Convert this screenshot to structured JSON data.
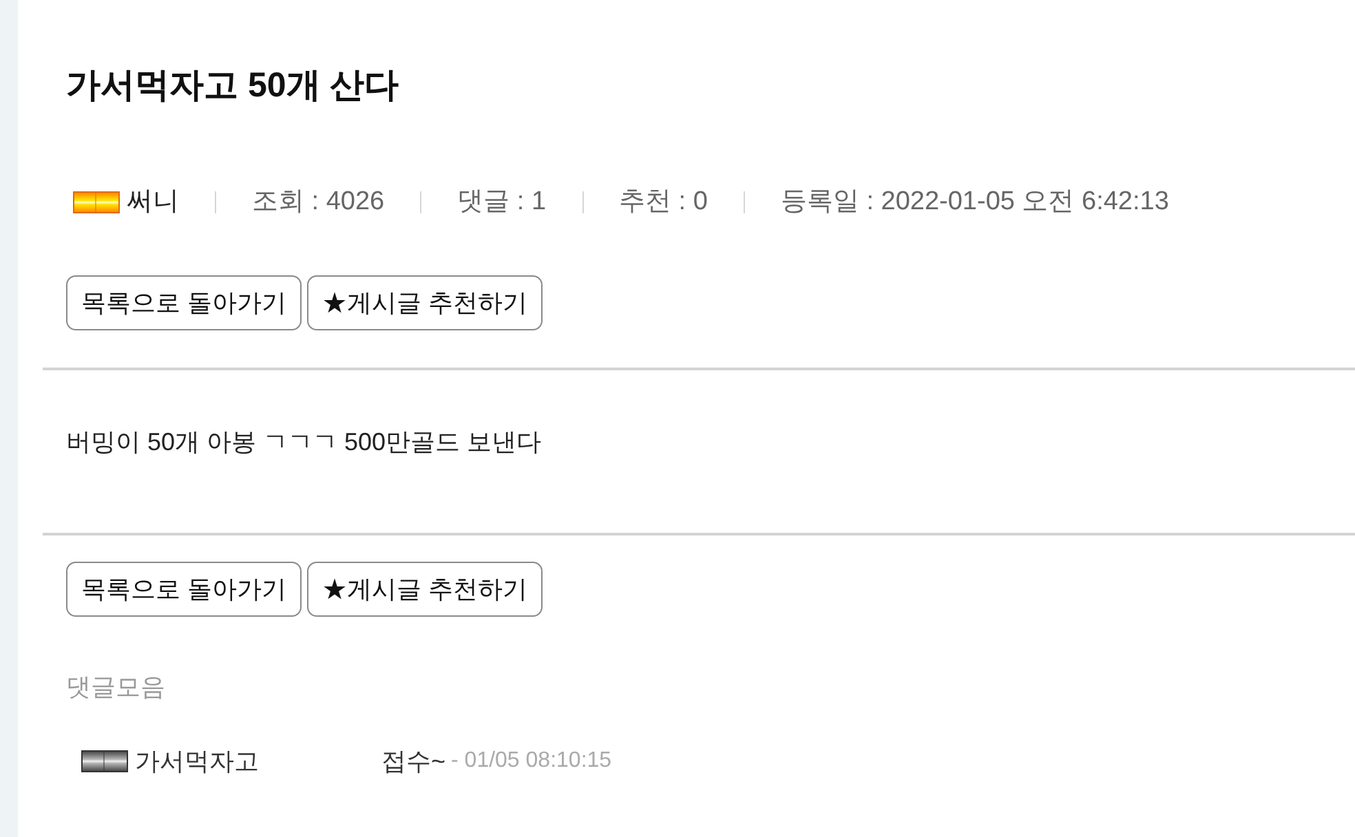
{
  "post": {
    "title": "가서먹자고 50개 산다",
    "author": {
      "name": "써니",
      "kind": "gold"
    },
    "meta": [
      "조회 : 4026",
      "댓글 : 1",
      "추천 : 0",
      "등록일 : 2022-01-05 오전 6:42:13"
    ]
  },
  "top_buttons": [
    "목록으로 돌아가기",
    "★게시글 추천하기"
  ],
  "body": "버밍이 50개 아봉 ㄱㄱㄱ 500만골드 보낸다",
  "bottom_buttons": [
    "목록으로 돌아가기",
    "★게시글 추천하기"
  ],
  "comments_heading": "댓글모음",
  "comments": [
    {
      "author": "가서먹자고",
      "kind": "silver",
      "text": "접수~",
      "time": "- 01/05 08:10:15"
    }
  ]
}
